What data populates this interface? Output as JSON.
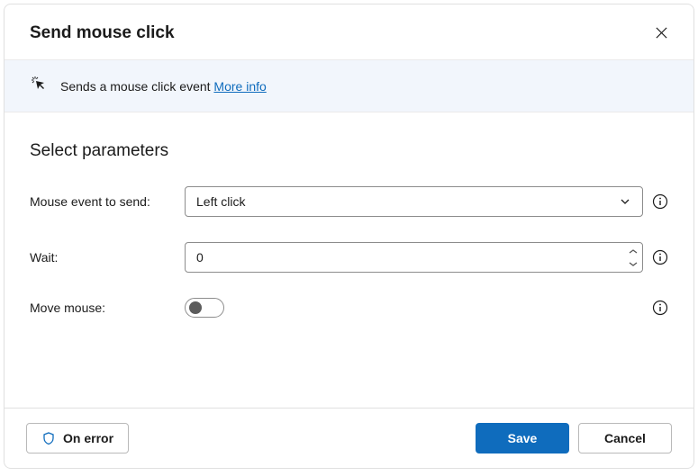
{
  "header": {
    "title": "Send mouse click"
  },
  "banner": {
    "text": "Sends a mouse click event ",
    "link": "More info"
  },
  "params": {
    "section_title": "Select parameters",
    "mouse_event": {
      "label": "Mouse event to send:",
      "value": "Left click"
    },
    "wait": {
      "label": "Wait:",
      "value": "0"
    },
    "move_mouse": {
      "label": "Move mouse:",
      "on": false
    }
  },
  "footer": {
    "on_error": "On error",
    "save": "Save",
    "cancel": "Cancel"
  }
}
